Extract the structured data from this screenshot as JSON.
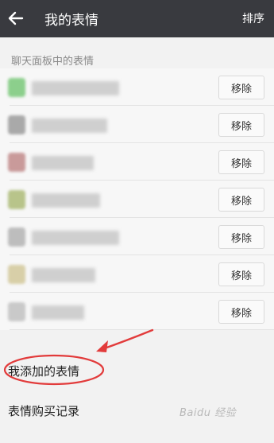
{
  "header": {
    "title": "我的表情",
    "sort_label": "排序"
  },
  "section": {
    "title": "聊天面板中的表情"
  },
  "items": [
    {
      "remove_label": "移除",
      "thumb_color": "#8ccf8c"
    },
    {
      "remove_label": "移除",
      "thumb_color": "#a9a9a9"
    },
    {
      "remove_label": "移除",
      "thumb_color": "#c99a9a"
    },
    {
      "remove_label": "移除",
      "thumb_color": "#b8c48a"
    },
    {
      "remove_label": "移除",
      "thumb_color": "#bdbdbd"
    },
    {
      "remove_label": "移除",
      "thumb_color": "#d8cfa8"
    },
    {
      "remove_label": "移除",
      "thumb_color": "#c9c9c9"
    }
  ],
  "links": {
    "added_emoji": "我添加的表情",
    "purchase_history": "表情购买记录"
  },
  "colors": {
    "header_bg": "#393a3f",
    "annotation_red": "#e23b3b"
  },
  "watermark": "Baidu 经验"
}
